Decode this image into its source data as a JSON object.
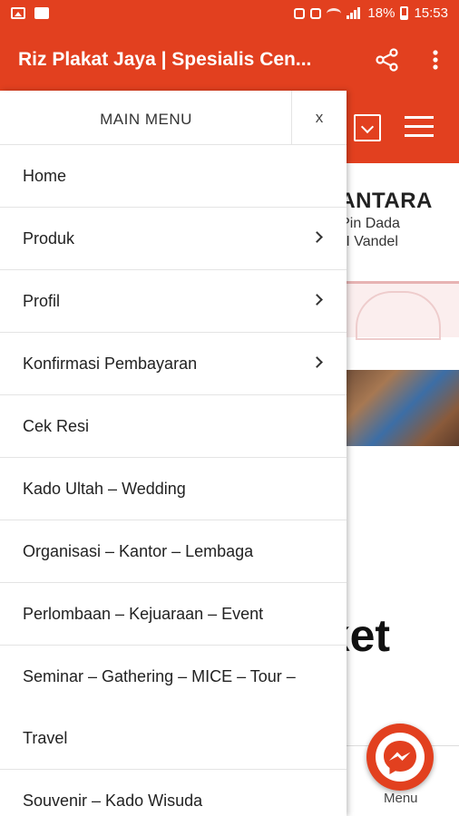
{
  "status_bar": {
    "battery": "18%",
    "time": "15:53"
  },
  "app_bar": {
    "title": "Riz Plakat Jaya | Spesialis Cen...",
    "share_icon": "share-icon",
    "more_icon": "more-vert-icon",
    "color": "#e2401f"
  },
  "web_page": {
    "brand": "USANTARA",
    "sub1": "& Pin Dada",
    "sub2": "hy I Vandel",
    "big_text": "aket",
    "fab_label": "Menu",
    "fab_icon": "messenger-icon"
  },
  "drawer": {
    "title": "MAIN MENU",
    "close": "x",
    "items": [
      {
        "label": "Home",
        "submenu": false
      },
      {
        "label": "Produk",
        "submenu": true
      },
      {
        "label": "Profil",
        "submenu": true
      },
      {
        "label": "Konfirmasi Pembayaran",
        "submenu": true
      },
      {
        "label": "Cek Resi",
        "submenu": false
      },
      {
        "label": "Kado Ultah – Wedding",
        "submenu": false
      },
      {
        "label": "Organisasi – Kantor – Lembaga",
        "submenu": false
      },
      {
        "label": "Perlombaan – Kejuaraan – Event",
        "submenu": false
      },
      {
        "label": "Seminar – Gathering – MICE – Tour –",
        "label2": "Travel",
        "submenu": false
      },
      {
        "label": "Souvenir – Kado Wisuda",
        "submenu": false
      }
    ]
  }
}
